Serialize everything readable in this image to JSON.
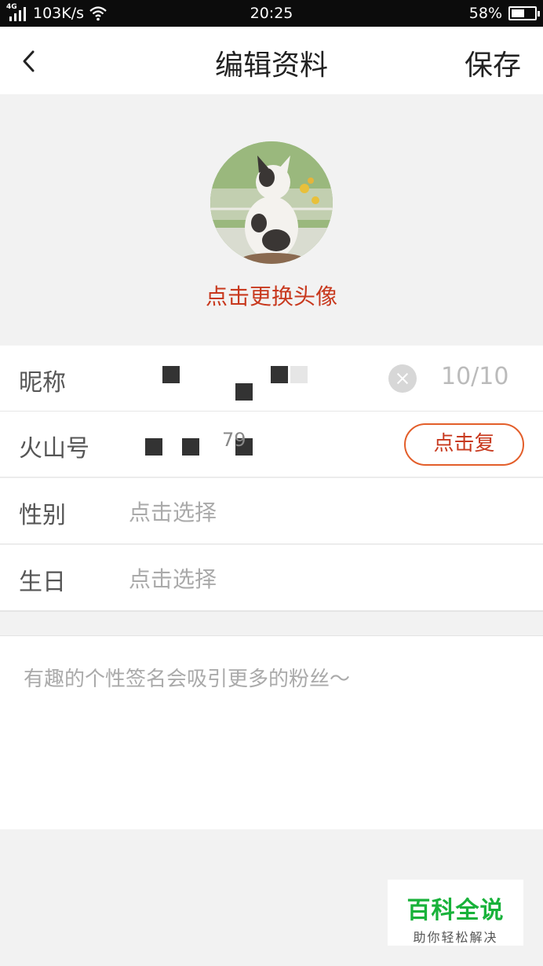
{
  "status_bar": {
    "network": "4G",
    "speed": "103K/s",
    "time": "20:25",
    "battery_percent": "58%",
    "battery_level": 0.58
  },
  "header": {
    "title": "编辑资料",
    "save_label": "保存",
    "back_icon": "chevron-left-icon"
  },
  "avatar": {
    "change_label": "点击更换头像"
  },
  "form": {
    "nickname": {
      "label": "昵称",
      "count": "10/10",
      "clear_icon": "clear-icon"
    },
    "huoshan_id": {
      "label": "火山号",
      "value_suffix": "79",
      "copy_label": "点击复"
    },
    "gender": {
      "label": "性别",
      "placeholder": "点击选择"
    },
    "birthday": {
      "label": "生日",
      "placeholder": "点击选择"
    }
  },
  "signature": {
    "placeholder": "有趣的个性签名会吸引更多的粉丝～"
  },
  "watermark": {
    "title": "百科全说",
    "subtitle": "助你轻松解决"
  },
  "colors": {
    "accent_red": "#c8391e",
    "watermark_green": "#18b23a",
    "status_bar": "#0c0c0c"
  }
}
